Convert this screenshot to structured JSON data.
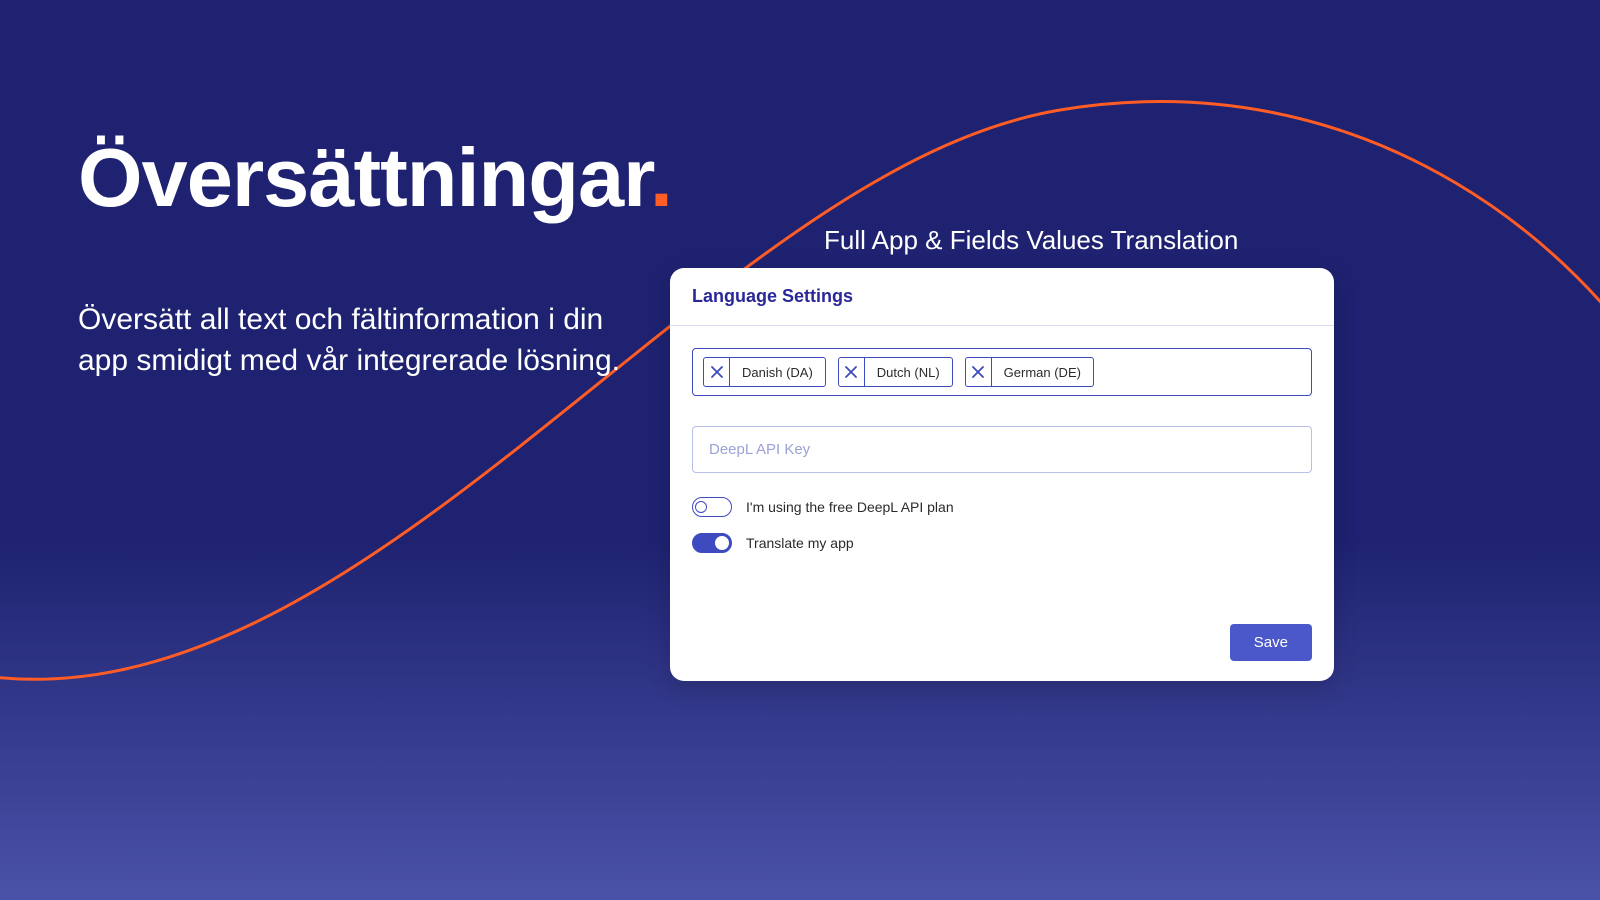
{
  "hero": {
    "title": "Översättningar",
    "subtitle": "Översätt all text och fältinformation i din app smidigt med vår integrerade lösning."
  },
  "panel": {
    "caption": "Full App & Fields Values Translation",
    "title": "Language Settings",
    "languages": [
      {
        "label": "Danish (DA)"
      },
      {
        "label": "Dutch (NL)"
      },
      {
        "label": "German (DE)"
      }
    ],
    "api_key_placeholder": "DeepL API Key",
    "toggles": {
      "free_plan": {
        "label": "I'm using the free DeepL API plan",
        "on": false
      },
      "translate_app": {
        "label": "Translate my app",
        "on": true
      }
    },
    "save_label": "Save"
  },
  "colors": {
    "accent": "#ff5c26",
    "primary": "#3e4abf"
  }
}
